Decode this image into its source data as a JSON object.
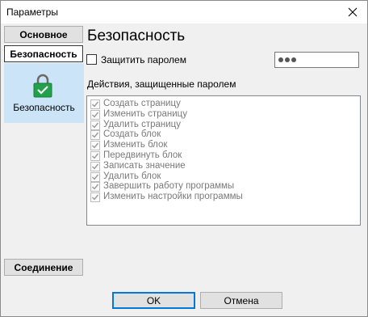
{
  "window": {
    "title": "Параметры"
  },
  "sidebar": {
    "main_label": "Основное",
    "security_label": "Безопасность",
    "panel_label": "Безопасность",
    "connection_label": "Соединение"
  },
  "content": {
    "title": "Безопасность",
    "protect_label": "Защитить паролем",
    "protect_checked": false,
    "password_mask_length": 3,
    "actions_label": "Действия, защищенные паролем",
    "actions": [
      {
        "label": "Создать страницу",
        "checked": true
      },
      {
        "label": "Изменить страницу",
        "checked": true
      },
      {
        "label": "Удалить страницу",
        "checked": true
      },
      {
        "label": "Создать блок",
        "checked": true
      },
      {
        "label": "Изменить блок",
        "checked": true
      },
      {
        "label": "Передвинуть блок",
        "checked": true
      },
      {
        "label": "Записать значение",
        "checked": true
      },
      {
        "label": "Удалить блок",
        "checked": true
      },
      {
        "label": "Завершить работу программы",
        "checked": true
      },
      {
        "label": "Изменить настройки программы",
        "checked": true
      }
    ]
  },
  "footer": {
    "ok_label": "OK",
    "cancel_label": "Отмена"
  },
  "icons": {
    "close": "close-icon",
    "lock": "lock-icon",
    "check": "check-icon"
  },
  "colors": {
    "selection": "#cce4f7",
    "lock_green": "#22a14a",
    "default_border": "#0078d7"
  }
}
